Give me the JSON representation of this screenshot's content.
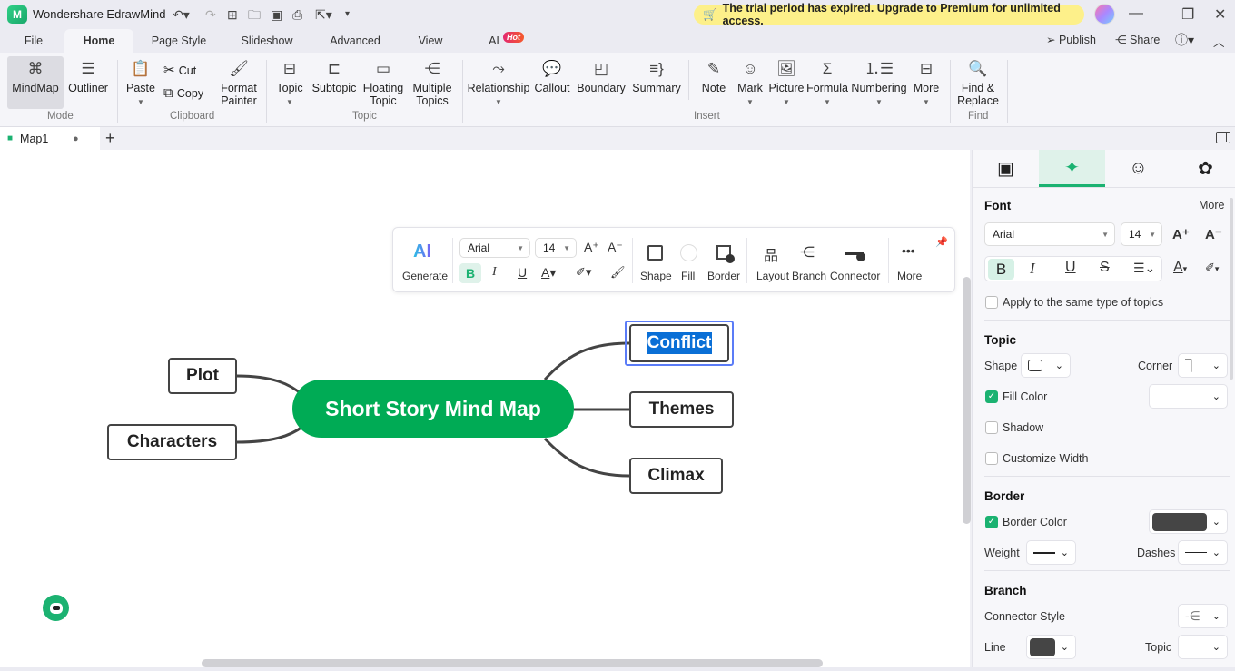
{
  "app": {
    "title": "Wondershare EdrawMind",
    "logo": "M"
  },
  "quick_access": [
    "undo-icon",
    "redo-icon",
    "new-icon",
    "open-icon",
    "save-icon",
    "print-icon",
    "export-icon",
    "customize-icon"
  ],
  "trial_banner": "The trial period has expired. Upgrade to Premium for unlimited access.",
  "menu": {
    "tabs": [
      "File",
      "Home",
      "Page Style",
      "Slideshow",
      "Advanced",
      "View",
      "AI"
    ],
    "active": "Home",
    "ai_badge": "Hot",
    "publish": "Publish",
    "share": "Share"
  },
  "ribbon": {
    "mode": {
      "label": "Mode",
      "mindmap": "MindMap",
      "outliner": "Outliner"
    },
    "clipboard": {
      "label": "Clipboard",
      "paste": "Paste",
      "cut": "Cut",
      "copy": "Copy",
      "format_painter_1": "Format",
      "format_painter_2": "Painter"
    },
    "topic": {
      "label": "Topic",
      "topic": "Topic",
      "subtopic": "Subtopic",
      "floating_1": "Floating",
      "floating_2": "Topic",
      "multiple_1": "Multiple",
      "multiple_2": "Topics"
    },
    "insert": {
      "label": "Insert",
      "relationship": "Relationship",
      "callout": "Callout",
      "boundary": "Boundary",
      "summary": "Summary",
      "note": "Note",
      "mark": "Mark",
      "picture": "Picture",
      "formula": "Formula",
      "numbering": "Numbering",
      "more": "More"
    },
    "find": {
      "label": "Find",
      "find_1": "Find &",
      "find_2": "Replace"
    }
  },
  "document": {
    "tab": "Map1"
  },
  "floatbar": {
    "ai": "AI",
    "generate": "Generate",
    "font": "Arial",
    "size": "14",
    "bold": "B",
    "italic": "I",
    "underline": "U",
    "shape": "Shape",
    "fill": "Fill",
    "border": "Border",
    "layout": "Layout",
    "branch": "Branch",
    "connector": "Connector",
    "more": "More"
  },
  "mindmap": {
    "central": "Short Story Mind Map",
    "left": [
      "Plot",
      "Characters"
    ],
    "right": [
      "Conflict",
      "Themes",
      "Climax"
    ],
    "selected": "Conflict",
    "central_color": "#00ab55"
  },
  "panel": {
    "font": {
      "title": "Font",
      "more": "More",
      "family": "Arial",
      "size": "14",
      "apply_same": "Apply to the same type of topics"
    },
    "topic": {
      "title": "Topic",
      "shape": "Shape",
      "corner": "Corner",
      "fill_color": "Fill Color",
      "fill_checked": true,
      "shadow": "Shadow",
      "customize_width": "Customize Width"
    },
    "border": {
      "title": "Border",
      "border_color": "Border Color",
      "color": "#454545",
      "weight": "Weight",
      "dashes": "Dashes"
    },
    "branch": {
      "title": "Branch",
      "connector_style": "Connector Style",
      "line": "Line",
      "topic": "Topic",
      "line_color": "#454545"
    }
  }
}
